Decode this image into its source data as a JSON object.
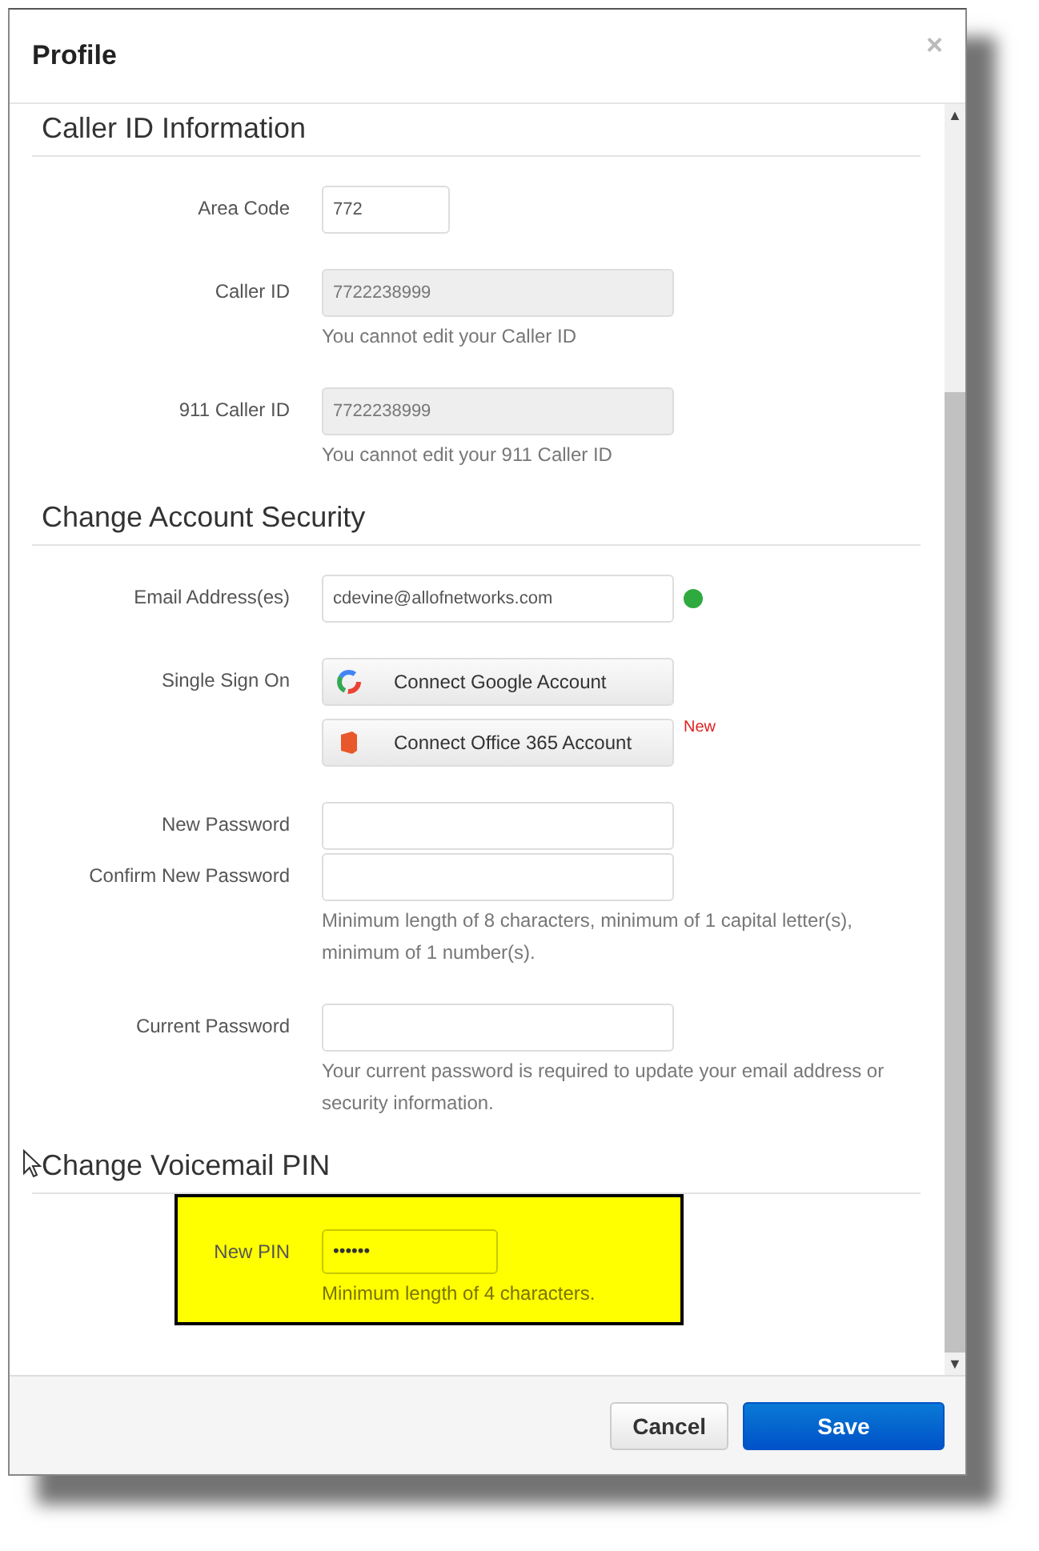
{
  "dialog": {
    "title": "Profile",
    "close": "×"
  },
  "sections": [
    {
      "heading": "Caller ID Information",
      "highlighted": false,
      "rows": [
        {
          "kind": "input",
          "label": "Area Code",
          "value": "772",
          "short": true,
          "disabled": false
        },
        {
          "kind": "input",
          "label": "Caller ID",
          "value": "7722238999",
          "short": false,
          "disabled": true,
          "hint": "You cannot edit your Caller ID"
        },
        {
          "kind": "input",
          "label": "911 Caller ID",
          "value": "7722238999",
          "short": false,
          "disabled": true,
          "hint": "You cannot edit your 911 Caller ID"
        }
      ]
    },
    {
      "heading": "Change Account Security",
      "highlighted": false,
      "rows": [
        {
          "kind": "input",
          "label": "Email Address(es)",
          "value": "cdevine@allofnetworks.com",
          "short": false,
          "disabled": false,
          "verified": true
        },
        {
          "kind": "sso",
          "label": "Single Sign On",
          "buttons": [
            {
              "label": "Connect Google Account"
            },
            {
              "label": "Connect Office 365 Account",
              "badge": "New"
            }
          ]
        },
        {
          "kind": "password",
          "label": "New Password"
        },
        {
          "kind": "password",
          "label": "Confirm New Password",
          "hint": "Minimum length of 8 characters, minimum of 1 capital letter(s), minimum of 1 number(s)."
        },
        {
          "kind": "password",
          "label": "Current Password",
          "hint": "Your current password is required to update your email address or security information."
        }
      ]
    },
    {
      "heading": "Change Voicemail PIN",
      "highlighted": true,
      "rows": [
        {
          "kind": "password",
          "label": "New PIN",
          "value": "••••••",
          "hint": "Minimum length of 4 characters."
        }
      ]
    }
  ],
  "scrollbar": {
    "up": "▲",
    "down": "▼"
  },
  "buttons": [
    {
      "label": "Cancel",
      "kind": "default"
    },
    {
      "label": "Save",
      "kind": "primary"
    }
  ]
}
